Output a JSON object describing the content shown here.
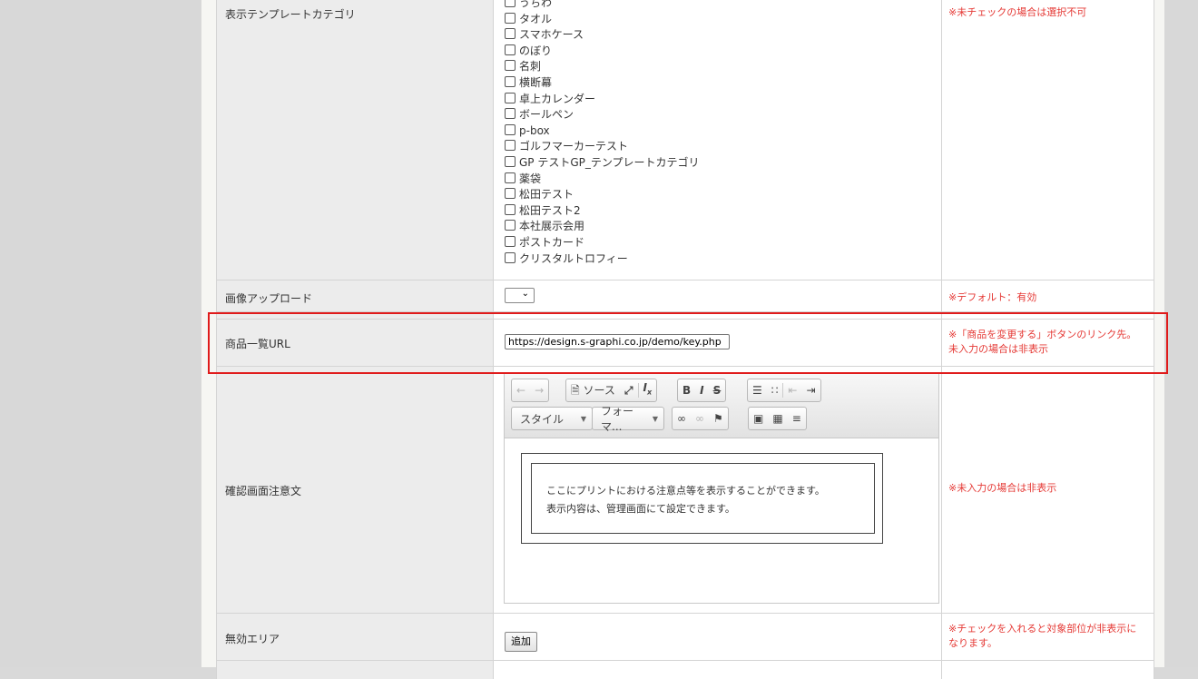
{
  "rows": {
    "template_category": {
      "label": "表示テンプレートカテゴリ",
      "options": [
        "うちわ",
        "タオル",
        "スマホケース",
        "のぼり",
        "名刺",
        "横断幕",
        "卓上カレンダー",
        "ボールペン",
        "p-box",
        "ゴルフマーカーテスト",
        "GP テストGP_テンプレートカテゴリ",
        "薬袋",
        "松田テスト",
        "松田テスト2",
        "本社展示会用",
        "ポストカード",
        "クリスタルトロフィー"
      ],
      "note": "※未チェックの場合は選択不可"
    },
    "image_upload": {
      "label": "画像アップロード",
      "select_value": "",
      "note": "※デフォルト：有効"
    },
    "product_url": {
      "label": "商品一覧URL",
      "value": "https://design.s-graphi.co.jp/demo/key.php",
      "note_line1": "※「商品を変更する」ボタンのリンク先。",
      "note_line2": "未入力の場合は非表示"
    },
    "confirm_notice": {
      "label": "確認画面注意文",
      "toolbar": {
        "source": "ソース",
        "style_combo": "スタイル",
        "format_combo": "フォーマ..."
      },
      "content_line1": "ここにプリントにおける注意点等を表示することができます。",
      "content_line2": "表示内容は、管理画面にて設定できます。",
      "note": "※未入力の場合は非表示"
    },
    "disabled_area": {
      "label": "無効エリア",
      "button": "追加",
      "note_line1": "※チェックを入れると対象部位が非表示に",
      "note_line2": "なります。"
    }
  },
  "colors": {
    "note_red": "#e53935",
    "highlight": "#e01b1b"
  }
}
